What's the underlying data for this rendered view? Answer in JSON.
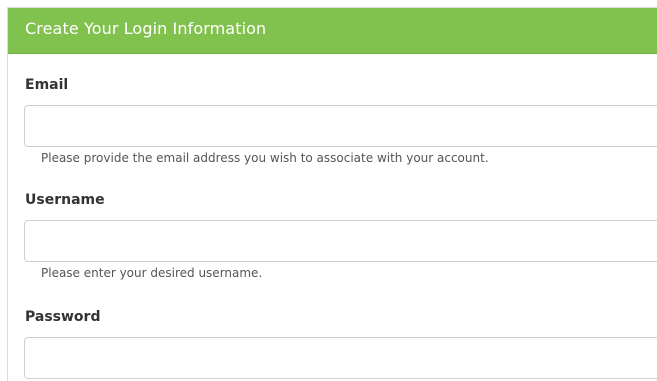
{
  "form": {
    "title": "Create Your Login Information",
    "email": {
      "label": "Email",
      "value": "",
      "placeholder": "",
      "help": "Please provide the email address you wish to associate with your account."
    },
    "username": {
      "label": "Username",
      "value": "",
      "placeholder": "",
      "help": "Please enter your desired username."
    },
    "password": {
      "label": "Password",
      "value": "",
      "placeholder": ""
    }
  },
  "colors": {
    "header_background": "#80c24d",
    "header_text": "#ffffff",
    "label_text": "#333333",
    "help_text": "#555555",
    "input_border": "#cfcfcf"
  }
}
